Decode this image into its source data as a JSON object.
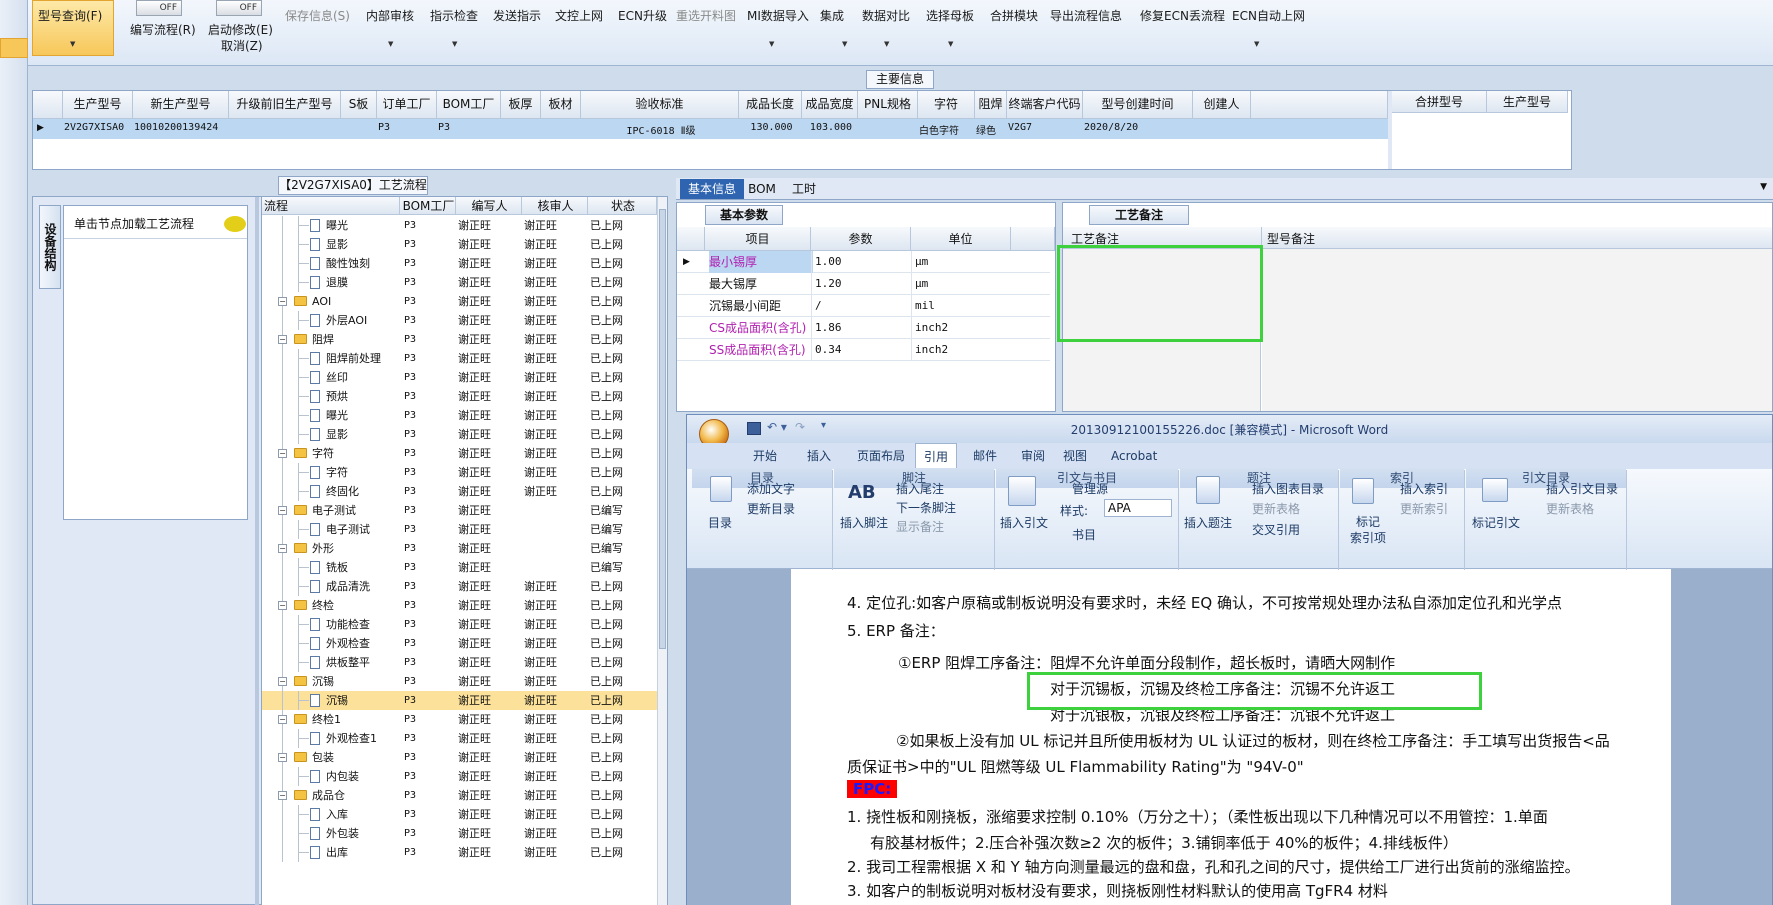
{
  "toolbar": {
    "items": [
      {
        "label": "型号查询(F)",
        "has_menu": true
      },
      {
        "label": "编写流程(R)",
        "switch": "OFF"
      },
      {
        "label": "启动修改(E)",
        "sub": "取消(Z)",
        "switch": "OFF"
      },
      {
        "label": "保存信息(S)",
        "disabled": true
      },
      {
        "label": "内部审核",
        "has_menu": true
      },
      {
        "label": "指示检查",
        "has_menu": true
      },
      {
        "label": "发送指示"
      },
      {
        "label": "文控上网"
      },
      {
        "label": "ECN升级"
      },
      {
        "label": "重选开料图",
        "disabled": true
      },
      {
        "label": "MI数据导入",
        "has_menu": true
      },
      {
        "label": "集成",
        "has_menu": true
      },
      {
        "label": "数据对比",
        "has_menu": true
      },
      {
        "label": "选择母板",
        "has_menu": true
      },
      {
        "label": "合拼模块"
      },
      {
        "label": "导出流程信息"
      },
      {
        "label": "修复ECN丢流程"
      },
      {
        "label": "ECN自动上网",
        "has_menu": true
      }
    ]
  },
  "main_info": {
    "title": "主要信息",
    "columns": [
      "生产型号",
      "新生产型号",
      "升级前旧生产型号",
      "S板",
      "订单工厂",
      "BOM工厂",
      "板厚",
      "板材",
      "验收标准",
      "成品长度",
      "成品宽度",
      "PNL规格",
      "字符",
      "阻焊",
      "终端客户代码",
      "型号创建时间",
      "创建人"
    ],
    "row": [
      "2V2G7XISA0",
      "10010200139424",
      "",
      "",
      "P3",
      "P3",
      "",
      "",
      "IPC-6018 Ⅱ级",
      "130.000",
      "103.000",
      "",
      "白色字符",
      "绿色",
      "V2G7",
      "2020/8/20",
      ""
    ],
    "merge_columns": [
      "合拼型号",
      "生产型号"
    ]
  },
  "process": {
    "title": "【2V2G7XISA0】工艺流程",
    "side_tab": "设备结构",
    "load_hint": "单击节点加载工艺流程",
    "columns": [
      "流程",
      "BOM工厂",
      "编写人",
      "核审人",
      "状态"
    ],
    "rows": [
      {
        "name": "曝光",
        "level": 2,
        "factory": "P3",
        "writer": "谢正旺",
        "checker": "谢正旺",
        "status": "已上网"
      },
      {
        "name": "显影",
        "level": 2,
        "factory": "P3",
        "writer": "谢正旺",
        "checker": "谢正旺",
        "status": "已上网"
      },
      {
        "name": "酸性蚀刻",
        "level": 2,
        "factory": "P3",
        "writer": "谢正旺",
        "checker": "谢正旺",
        "status": "已上网"
      },
      {
        "name": "退膜",
        "level": 2,
        "factory": "P3",
        "writer": "谢正旺",
        "checker": "谢正旺",
        "status": "已上网"
      },
      {
        "name": "AOI",
        "level": 1,
        "factory": "P3",
        "writer": "谢正旺",
        "checker": "谢正旺",
        "status": "已上网"
      },
      {
        "name": "外层AOI",
        "level": 2,
        "factory": "P3",
        "writer": "谢正旺",
        "checker": "谢正旺",
        "status": "已上网"
      },
      {
        "name": "阻焊",
        "level": 1,
        "factory": "P3",
        "writer": "谢正旺",
        "checker": "谢正旺",
        "status": "已上网"
      },
      {
        "name": "阻焊前处理",
        "level": 2,
        "factory": "P3",
        "writer": "谢正旺",
        "checker": "谢正旺",
        "status": "已上网"
      },
      {
        "name": "丝印",
        "level": 2,
        "factory": "P3",
        "writer": "谢正旺",
        "checker": "谢正旺",
        "status": "已上网"
      },
      {
        "name": "预烘",
        "level": 2,
        "factory": "P3",
        "writer": "谢正旺",
        "checker": "谢正旺",
        "status": "已上网"
      },
      {
        "name": "曝光",
        "level": 2,
        "factory": "P3",
        "writer": "谢正旺",
        "checker": "谢正旺",
        "status": "已上网"
      },
      {
        "name": "显影",
        "level": 2,
        "factory": "P3",
        "writer": "谢正旺",
        "checker": "谢正旺",
        "status": "已上网"
      },
      {
        "name": "字符",
        "level": 1,
        "factory": "P3",
        "writer": "谢正旺",
        "checker": "谢正旺",
        "status": "已上网"
      },
      {
        "name": "字符",
        "level": 2,
        "factory": "P3",
        "writer": "谢正旺",
        "checker": "谢正旺",
        "status": "已上网"
      },
      {
        "name": "终固化",
        "level": 2,
        "factory": "P3",
        "writer": "谢正旺",
        "checker": "谢正旺",
        "status": "已上网"
      },
      {
        "name": "电子测试",
        "level": 1,
        "factory": "P3",
        "writer": "谢正旺",
        "checker": "",
        "status": "已编写"
      },
      {
        "name": "电子测试",
        "level": 2,
        "factory": "P3",
        "writer": "谢正旺",
        "checker": "",
        "status": "已编写"
      },
      {
        "name": "外形",
        "level": 1,
        "factory": "P3",
        "writer": "谢正旺",
        "checker": "",
        "status": "已编写"
      },
      {
        "name": "铣板",
        "level": 2,
        "factory": "P3",
        "writer": "谢正旺",
        "checker": "",
        "status": "已编写"
      },
      {
        "name": "成品清洗",
        "level": 2,
        "factory": "P3",
        "writer": "谢正旺",
        "checker": "谢正旺",
        "status": "已上网"
      },
      {
        "name": "终检",
        "level": 1,
        "factory": "P3",
        "writer": "谢正旺",
        "checker": "谢正旺",
        "status": "已上网"
      },
      {
        "name": "功能检查",
        "level": 2,
        "factory": "P3",
        "writer": "谢正旺",
        "checker": "谢正旺",
        "status": "已上网"
      },
      {
        "name": "外观检查",
        "level": 2,
        "factory": "P3",
        "writer": "谢正旺",
        "checker": "谢正旺",
        "status": "已上网"
      },
      {
        "name": "烘板整平",
        "level": 2,
        "factory": "P3",
        "writer": "谢正旺",
        "checker": "谢正旺",
        "status": "已上网"
      },
      {
        "name": "沉锡",
        "level": 1,
        "factory": "P3",
        "writer": "谢正旺",
        "checker": "谢正旺",
        "status": "已上网"
      },
      {
        "name": "沉锡",
        "level": 2,
        "factory": "P3",
        "writer": "谢正旺",
        "checker": "谢正旺",
        "status": "已上网",
        "selected": true
      },
      {
        "name": "终检1",
        "level": 1,
        "factory": "P3",
        "writer": "谢正旺",
        "checker": "谢正旺",
        "status": "已上网"
      },
      {
        "name": "外观检查1",
        "level": 2,
        "factory": "P3",
        "writer": "谢正旺",
        "checker": "谢正旺",
        "status": "已上网"
      },
      {
        "name": "包装",
        "level": 1,
        "factory": "P3",
        "writer": "谢正旺",
        "checker": "谢正旺",
        "status": "已上网"
      },
      {
        "name": "内包装",
        "level": 2,
        "factory": "P3",
        "writer": "谢正旺",
        "checker": "谢正旺",
        "status": "已上网"
      },
      {
        "name": "成品仓",
        "level": 1,
        "factory": "P3",
        "writer": "谢正旺",
        "checker": "谢正旺",
        "status": "已上网"
      },
      {
        "name": "入库",
        "level": 2,
        "factory": "P3",
        "writer": "谢正旺",
        "checker": "谢正旺",
        "status": "已上网"
      },
      {
        "name": "外包装",
        "level": 2,
        "factory": "P3",
        "writer": "谢正旺",
        "checker": "谢正旺",
        "status": "已上网"
      },
      {
        "name": "出库",
        "level": 2,
        "factory": "P3",
        "writer": "谢正旺",
        "checker": "谢正旺",
        "status": "已上网"
      }
    ]
  },
  "right_tabs": [
    "基本信息",
    "BOM",
    "工时"
  ],
  "basic_params": {
    "title": "基本参数",
    "columns": [
      "项目",
      "参数",
      "单位"
    ],
    "rows": [
      {
        "item": "最小锡厚",
        "value": "1.00",
        "unit": "μm",
        "highlight": true
      },
      {
        "item": "最大锡厚",
        "value": "1.20",
        "unit": "μm",
        "highlight": false
      },
      {
        "item": "沉锡最小间距",
        "value": "/",
        "unit": "mil",
        "highlight": false
      },
      {
        "item": "CS成品面积(含孔)",
        "value": "1.86",
        "unit": "inch2",
        "highlight": true
      },
      {
        "item": "SS成品面积(含孔)",
        "value": "0.34",
        "unit": "inch2",
        "highlight": true
      }
    ]
  },
  "process_notes": {
    "title": "工艺备注",
    "columns": [
      "工艺备注",
      "型号备注"
    ]
  },
  "word": {
    "title": "20130912100155226.doc [兼容模式] - Microsoft Word",
    "tabs": [
      "开始",
      "插入",
      "页面布局",
      "引用",
      "邮件",
      "审阅",
      "视图",
      "Acrobat"
    ],
    "active_tab": "引用",
    "ribbon": {
      "toc": "目录",
      "add_text": "添加文字",
      "update_toc": "更新目录",
      "group_toc": "目录",
      "insert_footnote": "插入脚注",
      "insert_endnote": "插入尾注",
      "next_footnote": "下一条脚注",
      "show_notes": "显示备注",
      "group_footnote": "脚注",
      "insert_citation": "插入引文",
      "manage_sources": "管理源",
      "style_label": "样式:",
      "style_value": "APA",
      "bibliography": "书目",
      "group_citation": "引文与书目",
      "insert_caption": "插入题注",
      "insert_table_fig": "插入图表目录",
      "update_table": "更新表格",
      "cross_ref": "交叉引用",
      "group_caption": "题注",
      "mark_entry": "标记\n索引项",
      "insert_index": "插入索引",
      "update_index": "更新索引",
      "group_index": "索引",
      "mark_citation": "标记引文",
      "insert_toa": "插入引文目录",
      "update_toa": "更新表格",
      "group_toa": "引文目录",
      "ab_icon": "AB"
    },
    "doc_lines": [
      "4. 定位孔:如客户原稿或制板说明没有要求时，未经 EQ 确认，不可按常规处理办法私自添加定位孔和光学点",
      "5. ERP 备注：",
      "①ERP 阻焊工序备注：阻焊不允许单面分段制作，超长板时，请晒大网制作",
      "对于沉锡板，沉锡及终检工序备注：沉锡不允许返工",
      "对于沉银板，沉银及终检工序备注：沉银不允许返工",
      "②如果板上没有加 UL 标记并且所使用板材为 UL 认证过的板材，则在终检工序备注：手工填写出货报告<品",
      "质保证书>中的\"UL 阻燃等级 UL Flammability Rating\"为 \"94V-0\"",
      "FPC:",
      "1.  挠性板和刚挠板，涨缩要求控制  0.10%（万分之十）；（柔性板出现以下几种情况可以不用管控：1.单面",
      "有胶基材板件；2.压合补强次数≥2 次的板件；3.铺铜率低于 40%的板件；4.排线板件）",
      "2.  我司工程需根据 X 和 Y 轴方向测量最远的盘和盘，孔和孔之间的尺寸，提供给工厂进行出货前的涨缩监控。",
      "3. 如客户的制板说明对板材没有要求，则挠板刚性材料默认的使用高 TgFR4 材料"
    ]
  }
}
